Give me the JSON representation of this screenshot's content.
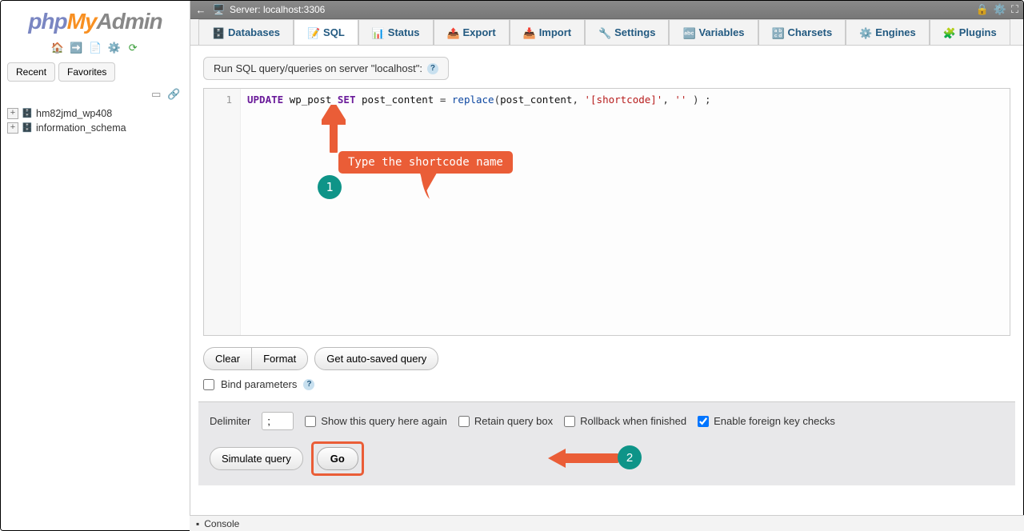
{
  "logo": {
    "p1": "php",
    "p2": "My",
    "p3": "Admin"
  },
  "sidebar": {
    "tabs": {
      "recent": "Recent",
      "favorites": "Favorites"
    },
    "databases": [
      "hm82jmd_wp408",
      "information_schema"
    ]
  },
  "topbar": {
    "server_label": "Server: localhost:3306"
  },
  "navtabs": [
    {
      "key": "databases",
      "label": "Databases"
    },
    {
      "key": "sql",
      "label": "SQL",
      "active": true
    },
    {
      "key": "status",
      "label": "Status"
    },
    {
      "key": "export",
      "label": "Export"
    },
    {
      "key": "import",
      "label": "Import"
    },
    {
      "key": "settings",
      "label": "Settings"
    },
    {
      "key": "variables",
      "label": "Variables"
    },
    {
      "key": "charsets",
      "label": "Charsets"
    },
    {
      "key": "engines",
      "label": "Engines"
    },
    {
      "key": "plugins",
      "label": "Plugins"
    }
  ],
  "panel": {
    "title": "Run SQL query/queries on server \"localhost\":"
  },
  "editor": {
    "line_number": "1",
    "kw_update": "UPDATE",
    "tbl": "wp_post",
    "kw_set": "SET",
    "col": "post_content",
    "eq": " = ",
    "fn": "replace",
    "open": "(",
    "arg1": "post_content",
    "sep1": ", ",
    "str1": "'[shortcode]'",
    "sep2": ", ",
    "str2": "''",
    "close": " ) ;"
  },
  "buttons": {
    "clear": "Clear",
    "format": "Format",
    "autosaved": "Get auto-saved query",
    "bind": "Bind parameters",
    "delimiter_label": "Delimiter",
    "delimiter_value": ";",
    "show_again": "Show this query here again",
    "retain": "Retain query box",
    "rollback": "Rollback when finished",
    "fk": "Enable foreign key checks",
    "simulate": "Simulate query",
    "go": "Go"
  },
  "console": {
    "label": "Console"
  },
  "annotations": {
    "a1_label": "Type the shortcode name",
    "a1_badge": "1",
    "a2_badge": "2"
  },
  "checked": {
    "fk": true
  }
}
